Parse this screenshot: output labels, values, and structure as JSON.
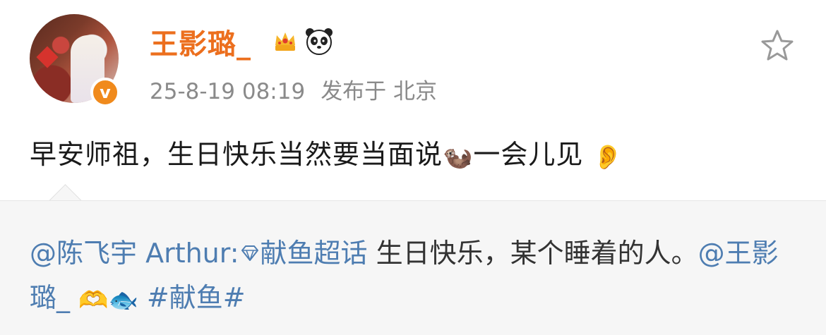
{
  "post": {
    "username": "王影璐_",
    "badges": [
      "crown-icon",
      "panda-icon"
    ],
    "timestamp": "25-8-19 08:19",
    "location": "发布于 北京",
    "content_text": "早安师祖，生日快乐当然要当面说",
    "content_emoji_1": "🦦",
    "content_text_2": "一会儿见",
    "content_emoji_2": "👂"
  },
  "repost": {
    "mention_author": "@陈飞宇 Arthur:",
    "topic": "献鱼超话",
    "text_1": " 生日快乐，某个睡着的人。",
    "mention_user": "@王影璐_",
    "emoji": "🫶🐟",
    "hashtag": "#献鱼#"
  },
  "colors": {
    "username": "#ec6f1e",
    "link": "#4e7db1",
    "meta": "#8a8a8a",
    "repost_bg": "#f6f6f6",
    "verified_badge": "#f08a1c"
  }
}
